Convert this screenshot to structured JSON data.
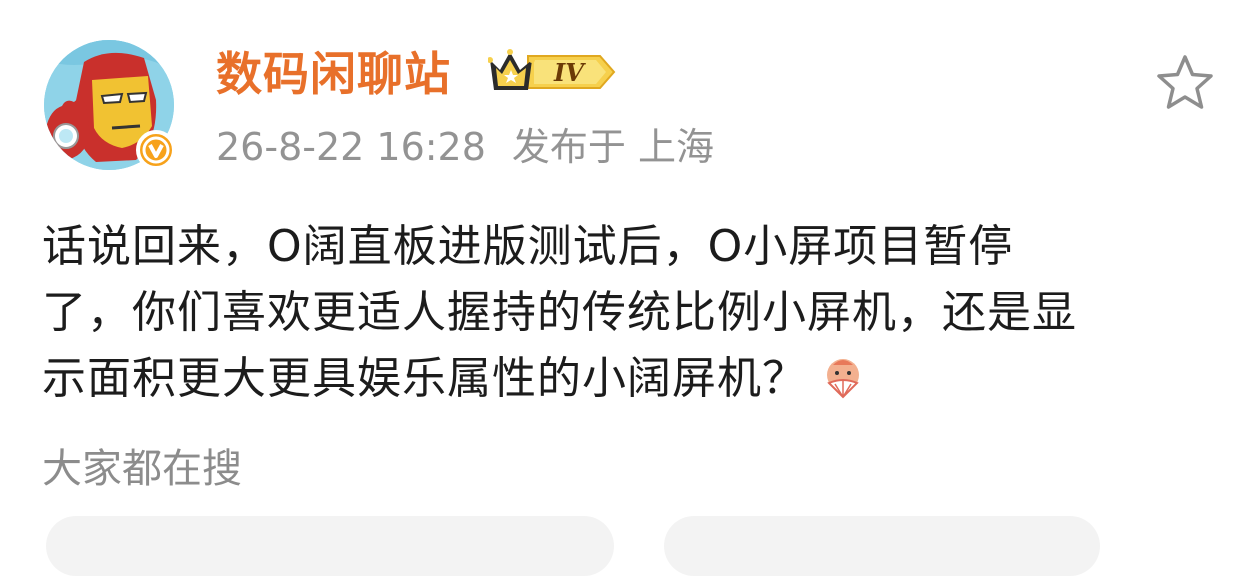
{
  "post": {
    "author": {
      "name": "数码闲聊站",
      "level_badge": "IV",
      "verified_mark": "V"
    },
    "meta": {
      "time": "26-8-22 16:28",
      "location": "发布于 上海"
    },
    "favorite_icon": "star-outline-icon",
    "content_lines": [
      "话说回来，O阔直板进版测试后，O小屏项目暂停",
      "了，你们喜欢更适人握持的传统比例小屏机，还是显",
      "示面积更大更具娱乐属性的小阔屏机？"
    ],
    "emoji": "emoji-sticker-icon"
  },
  "hot_search": {
    "label": "大家都在搜",
    "chips": [
      {
        "label": ""
      },
      {
        "label": ""
      }
    ]
  },
  "colors": {
    "username": "#e8702a",
    "meta_text": "#939393",
    "body_text": "#1c1c1c",
    "verified_badge": "#f7a21b",
    "vip_gold": "#f2c22b"
  }
}
